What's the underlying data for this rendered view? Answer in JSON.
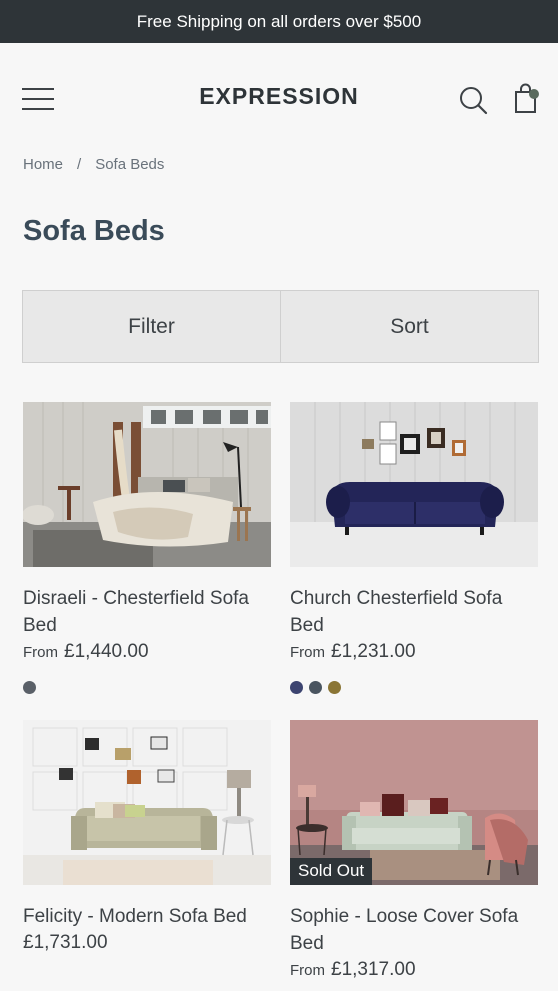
{
  "announcement": "Free Shipping on all orders over $500",
  "header": {
    "logo": "EXPRESSION",
    "menu_icon": "hamburger-menu-icon",
    "search_icon": "search-icon",
    "cart_icon": "shopping-bag-icon"
  },
  "breadcrumb": {
    "home": "Home",
    "separator": "/",
    "current": "Sofa Beds"
  },
  "page_title": "Sofa Beds",
  "toolbar": {
    "filter_label": "Filter",
    "sort_label": "Sort"
  },
  "products": [
    {
      "title": "Disraeli - Chesterfield Sofa Bed",
      "price_prefix": "From",
      "price": "£1,440.00",
      "swatches": [
        "#5a6068"
      ]
    },
    {
      "title": "Church Chesterfield Sofa Bed",
      "price_prefix": "From",
      "price": "£1,231.00",
      "swatches": [
        "#3c4470",
        "#4a5560",
        "#8a7535"
      ]
    },
    {
      "title": "Felicity - Modern Sofa Bed",
      "price_prefix": "",
      "price": "£1,731.00",
      "swatches": []
    },
    {
      "title": "Sophie - Loose Cover Sofa Bed",
      "price_prefix": "From",
      "price": "£1,317.00",
      "swatches": [],
      "badge": "Sold Out"
    }
  ],
  "colors": {
    "announcement_bg": "#2e3438",
    "title_color": "#3a4b59",
    "page_bg": "#f7f7f7"
  }
}
